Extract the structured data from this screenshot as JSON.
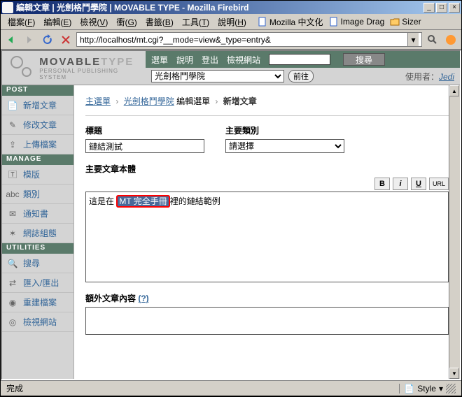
{
  "window": {
    "title": "編輯文章 | 光劍格鬥學院 | MOVABLE TYPE - Mozilla Firebird"
  },
  "menubar": {
    "items": [
      {
        "label": "檔案",
        "key": "F"
      },
      {
        "label": "編輯",
        "key": "E"
      },
      {
        "label": "檢視",
        "key": "V"
      },
      {
        "label": "衝",
        "key": "G"
      },
      {
        "label": "書籤",
        "key": "B"
      },
      {
        "label": "工具",
        "key": "T"
      },
      {
        "label": "說明",
        "key": "H"
      }
    ],
    "bookmarks": [
      {
        "label": "Mozilla 中文化",
        "icon": "doc"
      },
      {
        "label": "Image Drag",
        "icon": "doc"
      },
      {
        "label": "Sizer",
        "icon": "folder"
      }
    ]
  },
  "url": "http://localhost/mt.cgi?__mode=view&_type=entry&",
  "mt": {
    "logo_main": "MOVABLE",
    "logo_sub": "TYPE",
    "logo_tag": "PERSONAL PUBLISHING SYSTEM",
    "nav": [
      "選單",
      "說明",
      "登出",
      "檢視網站"
    ],
    "search_btn": "搜尋",
    "blog_selected": "光劍格鬥學院",
    "go": "前往",
    "user_label": "使用者：",
    "user_name": "Jedi"
  },
  "sidebar": {
    "sections": [
      {
        "header": "POST",
        "items": [
          {
            "label": "新增文章",
            "icon": "doc"
          },
          {
            "label": "修改文章",
            "icon": "edit"
          },
          {
            "label": "上傳檔案",
            "icon": "upload"
          }
        ]
      },
      {
        "header": "MANAGE",
        "items": [
          {
            "label": "模版",
            "icon": "template"
          },
          {
            "label": "類別",
            "icon": "cat"
          },
          {
            "label": "通知書",
            "icon": "mail"
          },
          {
            "label": "網誌組態",
            "icon": "gear"
          }
        ]
      },
      {
        "header": "UTILITIES",
        "items": [
          {
            "label": "搜尋",
            "icon": "search"
          },
          {
            "label": "匯入/匯出",
            "icon": "io"
          },
          {
            "label": "重建檔案",
            "icon": "rebuild"
          },
          {
            "label": "檢視網站",
            "icon": "view"
          }
        ]
      }
    ]
  },
  "breadcrumb": {
    "items": [
      "主選單",
      "光劍格鬥學院",
      "編輯選單"
    ],
    "current": "新增文章",
    "sep": "›"
  },
  "form": {
    "title_label": "標題",
    "title_value": "鏈結測試",
    "cat_label": "主要類別",
    "cat_value": "請選擇",
    "body_label": "主要文章本體",
    "body_prefix": "這是在 ",
    "body_highlight": "MT 完全手冊",
    "body_suffix": "裡的鏈結範例",
    "ext_label": "額外文章內容",
    "help": "(?)",
    "fmt": {
      "b": "B",
      "i": "i",
      "u": "U",
      "url": "URL"
    }
  },
  "status": {
    "text": "完成",
    "style": "Style"
  }
}
